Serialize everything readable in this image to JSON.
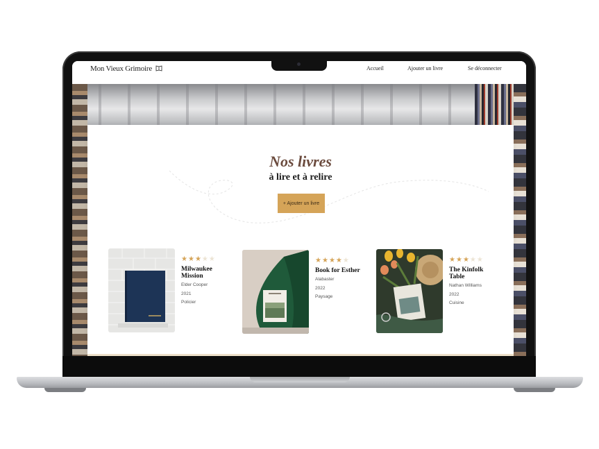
{
  "header": {
    "brand": "Mon Vieux Grimoire",
    "brand_icon": "open-book-icon",
    "nav": [
      {
        "label": "Accueil"
      },
      {
        "label": "Ajouter un livre"
      },
      {
        "label": "Se déconnecter"
      }
    ]
  },
  "main": {
    "title": "Nos livres",
    "subtitle": "à lire et à relire",
    "add_button": "+ Ajouter un livre"
  },
  "books": [
    {
      "title": "Milwaukee Mission",
      "author": "Elder Cooper",
      "year": "2021",
      "genre": "Policier",
      "rating": 3,
      "max_rating": 5
    },
    {
      "title": "Book for Esther",
      "author": "Alabaster",
      "year": "2022",
      "genre": "Paysage",
      "rating": 4,
      "max_rating": 5
    },
    {
      "title": "The Kinfolk Table",
      "author": "Nathan Williams",
      "year": "2022",
      "genre": "Cuisine",
      "rating": 3,
      "max_rating": 5
    }
  ],
  "colors": {
    "accent": "#d5a458",
    "title": "#6b4b3e",
    "star_off": "#ece4d4",
    "floor": "#f4e7cf"
  }
}
